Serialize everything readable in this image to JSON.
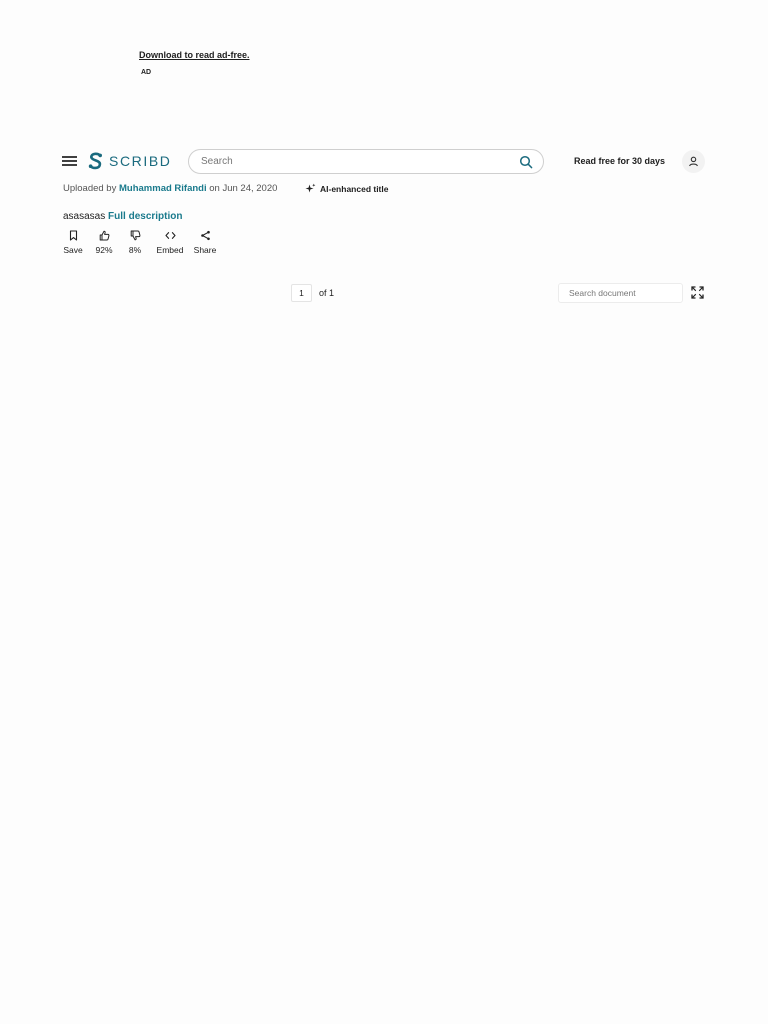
{
  "ad": {
    "download_link": "Download to read ad-free.",
    "tag": "AD"
  },
  "header": {
    "logo_text": "SCRIBD",
    "search_placeholder": "Search",
    "read_free": "Read free for 30 days"
  },
  "meta": {
    "uploaded_by_prefix": "Uploaded by",
    "author": "Muhammad Rifandi",
    "date_text": "on Jun 24, 2020",
    "ai_title": "AI-enhanced title"
  },
  "description": {
    "text": "asasasas",
    "full_link": "Full description"
  },
  "actions": [
    {
      "label": "Save",
      "icon": "bookmark-icon"
    },
    {
      "label": "92%",
      "icon": "thumbs-up-icon"
    },
    {
      "label": "8%",
      "icon": "thumbs-down-icon"
    },
    {
      "label": "Embed",
      "icon": "embed-code-icon"
    },
    {
      "label": "Share",
      "icon": "share-icon"
    }
  ],
  "viewer": {
    "page_number": "1",
    "page_of": "of 1",
    "search_placeholder": "Search document"
  },
  "colors": {
    "brand": "#1a6a7e",
    "link": "#1a7a8c"
  }
}
